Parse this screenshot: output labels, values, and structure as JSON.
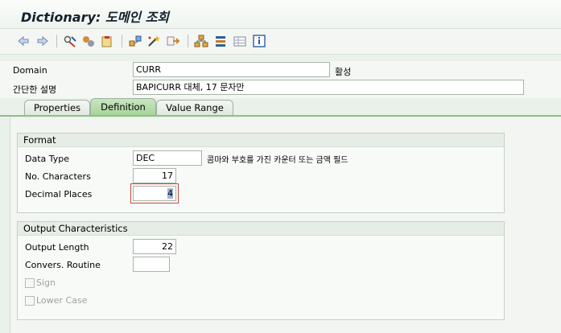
{
  "window": {
    "title": "Dictionary: 도메인 조회"
  },
  "toolbar": {
    "icons": [
      "back-icon",
      "forward-icon",
      "display-change-icon",
      "activate-icon",
      "check-icon",
      "where-used-icon",
      "wand-icon",
      "navigate-icon",
      "hierarchy-icon",
      "stack-icon",
      "table-icon",
      "info-icon"
    ]
  },
  "header": {
    "domain_label": "Domain",
    "domain_value": "CURR",
    "status": "활성",
    "short_desc_label": "간단한 설명",
    "short_desc_value": "BAPICURR 대체, 17 문자만"
  },
  "tabs": [
    {
      "label": "Properties",
      "active": false
    },
    {
      "label": "Definition",
      "active": true
    },
    {
      "label": "Value Range",
      "active": false
    }
  ],
  "format": {
    "title": "Format",
    "data_type_label": "Data Type",
    "data_type_value": "DEC",
    "data_type_desc": "콤마와 부호를 가진 카운터 또는 금액 필드",
    "no_chars_label": "No. Characters",
    "no_chars_value": "17",
    "decimals_label": "Decimal Places",
    "decimals_value": "4"
  },
  "output": {
    "title": "Output Characteristics",
    "length_label": "Output Length",
    "length_value": "22",
    "convers_label": "Convers. Routine",
    "convers_value": "",
    "sign_label": "Sign",
    "lower_label": "Lower Case"
  },
  "colors": {
    "accent": "#a7d29a",
    "focus": "#c74a3a",
    "icon_blue": "#2c5fa0"
  }
}
